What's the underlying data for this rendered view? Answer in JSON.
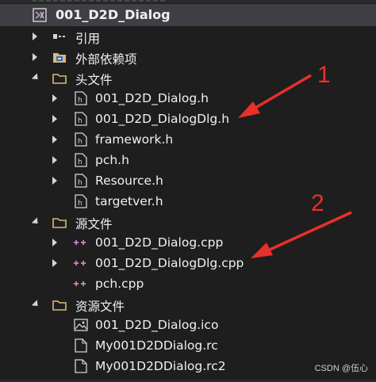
{
  "project": {
    "name": "001_D2D_Dialog"
  },
  "tree": {
    "references": "引用",
    "external_deps": "外部依赖项",
    "header_folder": "头文件",
    "header_files": [
      "001_D2D_Dialog.h",
      "001_D2D_DialogDlg.h",
      "framework.h",
      "pch.h",
      "Resource.h",
      "targetver.h"
    ],
    "source_folder": "源文件",
    "source_files": [
      "001_D2D_Dialog.cpp",
      "001_D2D_DialogDlg.cpp",
      "pch.cpp"
    ],
    "resource_folder": "资源文件",
    "resource_files": [
      "001_D2D_Dialog.ico",
      "My001D2DDialog.rc",
      "My001D2DDialog.rc2"
    ]
  },
  "annotations": [
    "1",
    "2"
  ],
  "watermark": "CSDN @伍心",
  "colors": {
    "arrow": "#e8302a",
    "folder": "#dcb67a",
    "cpp": "#c586c0",
    "selected_bg": "#3f3f46"
  }
}
